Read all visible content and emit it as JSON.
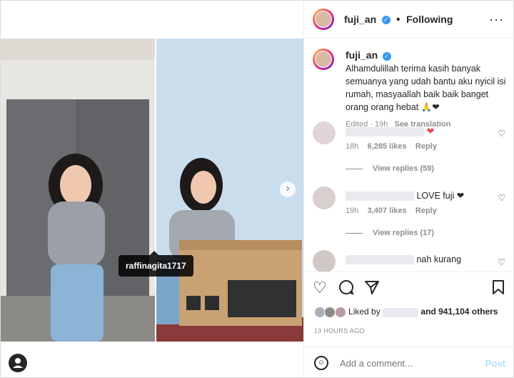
{
  "post": {
    "tag_label": "raffinagita1717"
  },
  "header": {
    "username": "fuji_an",
    "separator": "•",
    "follow_status": "Following",
    "more": "···"
  },
  "caption": {
    "username": "fuji_an",
    "text": "Alhamdulillah terima kasih banyak semuanya yang udah bantu aku nyicil isi rumah, masyaallah baik baik banget orang orang hebat 🙏❤",
    "edited": "Edited · 19h",
    "see_translation": "See translation"
  },
  "comments": [
    {
      "text": "❤",
      "time": "18h",
      "likes": "6,285 likes",
      "reply": "Reply",
      "view_replies": "View replies (59)"
    },
    {
      "text": "LOVE fuji ❤",
      "time": "19h",
      "likes": "3,407 likes",
      "reply": "Reply",
      "view_replies": "View replies (17)"
    },
    {
      "text": "nah kurang"
    }
  ],
  "engagement": {
    "liked_by_prefix": "Liked by",
    "liked_by_suffix": "and 941,104 others",
    "time_ago": "19 HOURS AGO"
  },
  "add_comment": {
    "placeholder": "Add a comment...",
    "post_label": "Post"
  },
  "icons": [
    "heart-icon",
    "comment-icon",
    "share-icon",
    "bookmark-icon",
    "emoji-icon",
    "more-icon",
    "verified-icon",
    "user-tag-icon",
    "chevron-right-icon"
  ],
  "colors": {
    "accent": "#0095f6",
    "post_disabled": "#b2dffc",
    "heart": "#ed4956",
    "verified": "#3897f0"
  }
}
